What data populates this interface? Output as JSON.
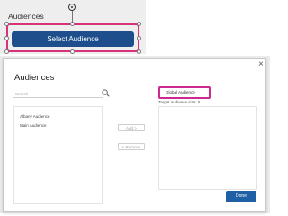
{
  "widget": {
    "title": "Audiences",
    "select_button_label": "Select Audience"
  },
  "modal": {
    "title": "Audiences",
    "close_icon": "×",
    "search": {
      "placeholder": "Search",
      "value": ""
    },
    "audience_list": [
      {
        "label": "Albany Audience"
      },
      {
        "label": "Main Audience"
      }
    ],
    "add_label": "Add >",
    "remove_label": "< Remove",
    "selected_audience": "Global Audience",
    "target_size_text": "Target audience size: 5",
    "done_label": "Done"
  },
  "colors": {
    "primary": "#1e4f8c",
    "done": "#1e5fa6",
    "highlight": "#cc2a8f"
  }
}
